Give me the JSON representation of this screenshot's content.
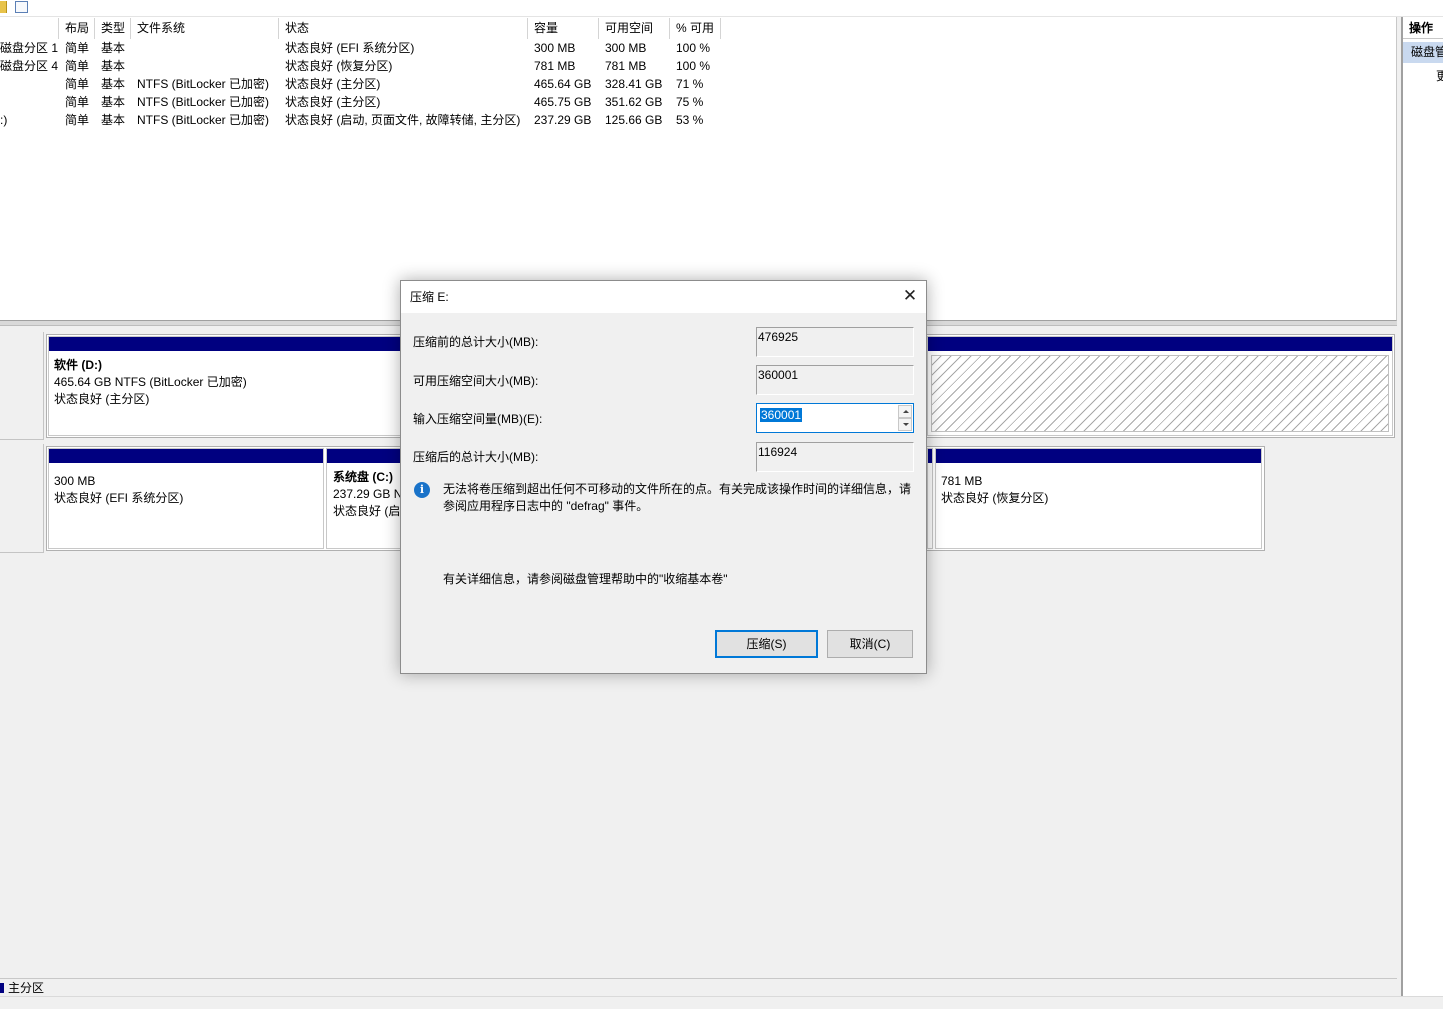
{
  "volume_list": {
    "columns": [
      "布局",
      "类型",
      "文件系统",
      "状态",
      "容量",
      "可用空间",
      "% 可用"
    ],
    "rows": [
      {
        "name": "磁盘分区 1)",
        "layout": "简单",
        "type": "基本",
        "fs": "",
        "status": "状态良好 (EFI 系统分区)",
        "capacity": "300 MB",
        "free": "300 MB",
        "pct": "100 %"
      },
      {
        "name": "磁盘分区 4)",
        "layout": "简单",
        "type": "基本",
        "fs": "",
        "status": "状态良好 (恢复分区)",
        "capacity": "781 MB",
        "free": "781 MB",
        "pct": "100 %"
      },
      {
        "name": "",
        "layout": "简单",
        "type": "基本",
        "fs": "NTFS (BitLocker 已加密)",
        "status": "状态良好 (主分区)",
        "capacity": "465.64 GB",
        "free": "328.41 GB",
        "pct": "71 %"
      },
      {
        "name": "",
        "layout": "简单",
        "type": "基本",
        "fs": "NTFS (BitLocker 已加密)",
        "status": "状态良好 (主分区)",
        "capacity": "465.75 GB",
        "free": "351.62 GB",
        "pct": "75 %"
      },
      {
        "name": ":)",
        "layout": "简单",
        "type": "基本",
        "fs": "NTFS (BitLocker 已加密)",
        "status": "状态良好 (启动, 页面文件, 故障转储, 主分区)",
        "capacity": "237.29 GB",
        "free": "125.66 GB",
        "pct": "53 %"
      }
    ]
  },
  "disk_view": {
    "disk1": {
      "volume_d": {
        "title": "软件   (D:)",
        "size": "465.64 GB NTFS (BitLocker 已加密)",
        "status": "状态良好 (主分区)"
      }
    },
    "disk0": {
      "efi": {
        "size": "300 MB",
        "status": "状态良好 (EFI 系统分区)"
      },
      "system_c": {
        "title": "系统盘   (C:)",
        "size": "237.29 GB N",
        "status": "状态良好 (启"
      },
      "recovery": {
        "size": "781 MB",
        "status": "状态良好 (恢复分区)"
      }
    }
  },
  "legend": {
    "primary_label": "主分区",
    "primary_color": "#000080"
  },
  "actions": {
    "header": "操作",
    "section": "磁盘管",
    "item": "更"
  },
  "dialog": {
    "title": "压缩 E:",
    "close_glyph": "✕",
    "total_before_label": "压缩前的总计大小(MB):",
    "total_before_value": "476925",
    "available_label": "可用压缩空间大小(MB):",
    "available_value": "360001",
    "input_label": "输入压缩空间量(MB)(E):",
    "input_value": "360001",
    "total_after_label": "压缩后的总计大小(MB):",
    "total_after_value": "116924",
    "info_glyph": "i",
    "info_text": "无法将卷压缩到超出任何不可移动的文件所在的点。有关完成该操作时间的详细信息，请参阅应用程序日志中的 \"defrag\" 事件。",
    "more_info": "有关详细信息，请参阅磁盘管理帮助中的\"收缩基本卷\"",
    "shrink_button": "压缩(S)",
    "cancel_button": "取消(C)"
  },
  "colors": {
    "accent": "#0078d7",
    "partition_bar": "#000080",
    "selection": "#c9d9ef"
  }
}
